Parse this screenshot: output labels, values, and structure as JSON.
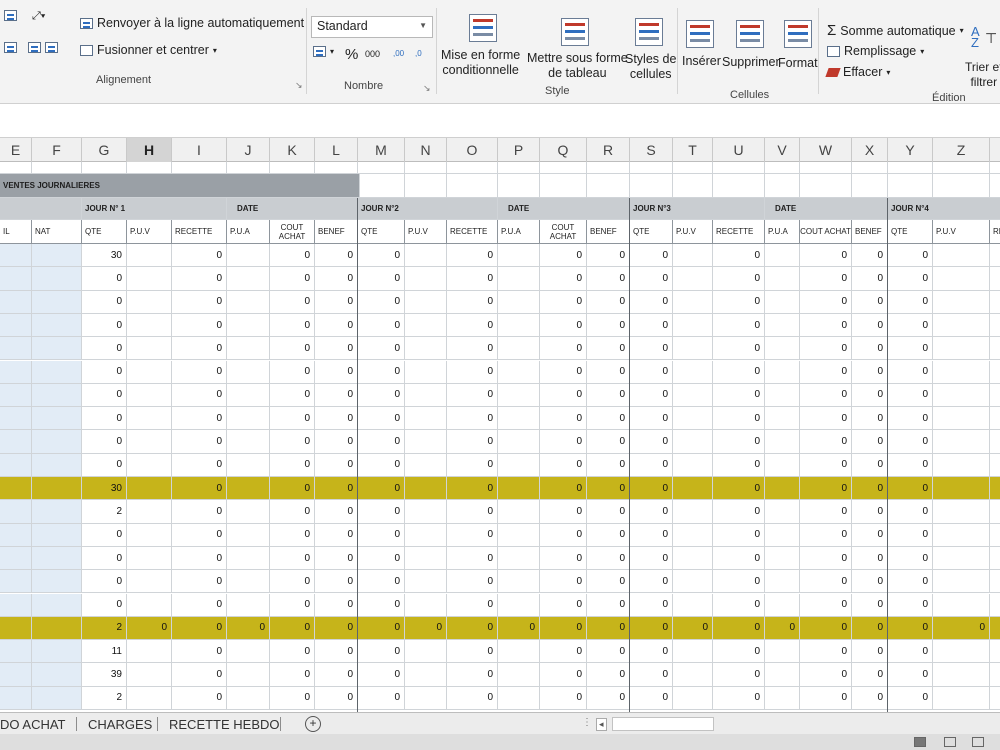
{
  "ribbon": {
    "alignment": {
      "wrap_text": "Renvoyer à la ligne automatiquement",
      "merge_center": "Fusionner et centrer",
      "label": "Alignement"
    },
    "number": {
      "format_value": "Standard",
      "percent": "%",
      "thousands": "000",
      "inc_decimal": ",00",
      "dec_decimal": ",0",
      "label": "Nombre"
    },
    "style": {
      "conditional_line1": "Mise en forme",
      "conditional_line2": "conditionnelle",
      "table_line1": "Mettre sous forme",
      "table_line2": "de tableau",
      "cellstyles_line1": "Styles de",
      "cellstyles_line2": "cellules",
      "label": "Style"
    },
    "cells": {
      "insert": "Insérer",
      "delete": "Supprimer",
      "format": "Format",
      "label": "Cellules"
    },
    "editing": {
      "autosum": "Somme automatique",
      "fill": "Remplissage",
      "clear": "Effacer",
      "sort_line1": "Trier et",
      "sort_line2": "filtrer",
      "label": "Édition"
    }
  },
  "columns": [
    {
      "letter": "E"
    },
    {
      "letter": "F"
    },
    {
      "letter": "G"
    },
    {
      "letter": "H"
    },
    {
      "letter": "I"
    },
    {
      "letter": "J"
    },
    {
      "letter": "K"
    },
    {
      "letter": "L"
    },
    {
      "letter": "M"
    },
    {
      "letter": "N"
    },
    {
      "letter": "O"
    },
    {
      "letter": "P"
    },
    {
      "letter": "Q"
    },
    {
      "letter": "R"
    },
    {
      "letter": "S"
    },
    {
      "letter": "T"
    },
    {
      "letter": "U"
    },
    {
      "letter": "V"
    },
    {
      "letter": "W"
    },
    {
      "letter": "X"
    },
    {
      "letter": "Y"
    },
    {
      "letter": "Z"
    }
  ],
  "sheet": {
    "title": "VENTES JOURNALIERES",
    "groups": [
      {
        "jour": "JOUR N° 1",
        "date": "DATE"
      },
      {
        "jour": "JOUR N°2",
        "date": "DATE"
      },
      {
        "jour": "JOUR N°3",
        "date": "DATE"
      },
      {
        "jour": "JOUR N°4",
        "date": ""
      }
    ],
    "subheaders": {
      "first": "IL",
      "nat": "NAT",
      "qte": "QTE",
      "puv": "P.U.V",
      "recette": "RECETTE",
      "pua": "P.U.A",
      "cout": "COUT ACHAT",
      "benef": "BENEF",
      "rece_cut": "RECE"
    },
    "rows": [
      {
        "g": "30",
        "rest": "0"
      },
      {
        "g": "0",
        "rest": "0"
      },
      {
        "g": "0",
        "rest": "0"
      },
      {
        "g": "0",
        "rest": "0"
      },
      {
        "g": "0",
        "rest": "0"
      },
      {
        "g": "0",
        "rest": "0"
      },
      {
        "g": "0",
        "rest": "0"
      },
      {
        "g": "0",
        "rest": "0"
      },
      {
        "g": "0",
        "rest": "0"
      },
      {
        "g": "0",
        "rest": "0"
      },
      {
        "g": "30",
        "rest": "0",
        "highlight": true
      },
      {
        "g": "2",
        "rest": "0"
      },
      {
        "g": "0",
        "rest": "0"
      },
      {
        "g": "0",
        "rest": "0"
      },
      {
        "g": "0",
        "rest": "0"
      },
      {
        "g": "0",
        "rest": "0"
      },
      {
        "g": "2",
        "rest": "0",
        "highlight": true,
        "fullzero": true
      },
      {
        "g": "11",
        "rest": "0"
      },
      {
        "g": "39",
        "rest": "0"
      },
      {
        "g": "2",
        "rest": "0"
      }
    ]
  },
  "tabs": [
    {
      "label": "DO ACHAT"
    },
    {
      "label": "CHARGES"
    },
    {
      "label": "RECETTE HEBDO"
    }
  ],
  "add_sheet": "+",
  "colors": {
    "highlight": "#c6b41a",
    "header_gray": "#c9cdd1",
    "title_gray": "#9aa0a6",
    "selection_tint": "#e2ecf6"
  }
}
